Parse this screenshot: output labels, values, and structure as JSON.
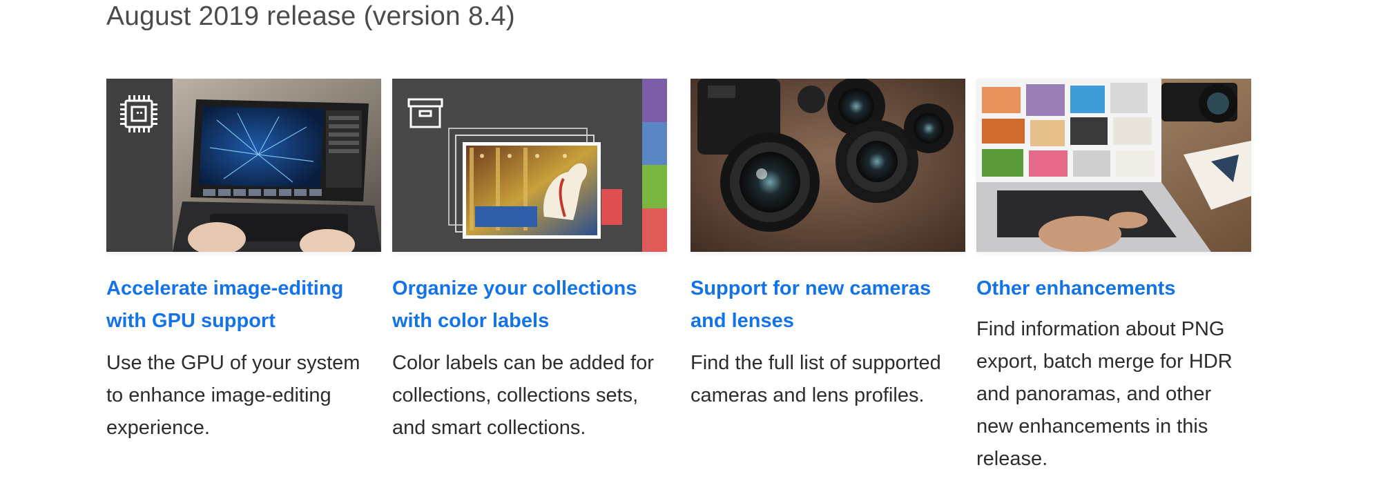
{
  "release": {
    "title": "August 2019 release (version 8.4)"
  },
  "cards": [
    {
      "title": "Accelerate image-editing with GPU support",
      "description": "Use the GPU of your system to enhance image-editing experience.",
      "icon": "gpu-chip-icon"
    },
    {
      "title": "Organize your collections with color labels",
      "description": "Color labels can be added for collections, collections sets, and smart collections.",
      "icon": "archive-box-icon",
      "label_colors": [
        "#7b5ea7",
        "#5a86c4",
        "#7ab640",
        "#e05a5a"
      ]
    },
    {
      "title": "Support for new cameras and lenses",
      "description": "Find the full list of supported cameras and lens profiles."
    },
    {
      "title": "Other enhancements",
      "description": "Find information about PNG export, batch merge for HDR and panoramas, and other new enhancements in this release."
    }
  ],
  "colors": {
    "link": "#1473e6",
    "heading": "#4b4b4b",
    "body_text": "#2c2c2c"
  }
}
